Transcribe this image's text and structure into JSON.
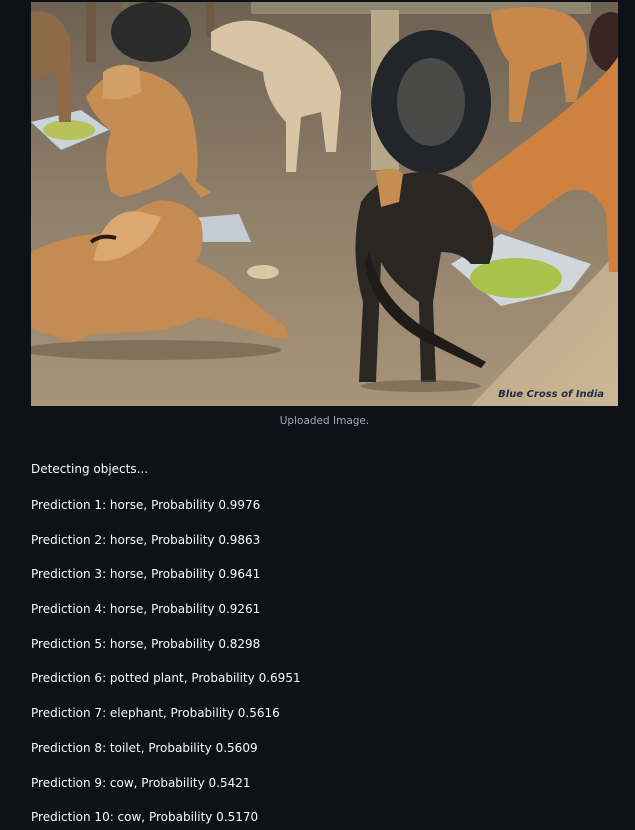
{
  "image": {
    "watermark": "Blue Cross of India",
    "caption": "Uploaded Image."
  },
  "status_text": "Detecting objects...",
  "predictions": [
    "Prediction 1: horse, Probability 0.9976",
    "Prediction 2: horse, Probability 0.9863",
    "Prediction 3: horse, Probability 0.9641",
    "Prediction 4: horse, Probability 0.9261",
    "Prediction 5: horse, Probability 0.8298",
    "Prediction 6: potted plant, Probability 0.6951",
    "Prediction 7: elephant, Probability 0.5616",
    "Prediction 8: toilet, Probability 0.5609",
    "Prediction 9: cow, Probability 0.5421",
    "Prediction 10: cow, Probability 0.5170"
  ],
  "colors": {
    "background": "#0e1117",
    "text": "#fafafa",
    "caption": "#a3a8b4"
  }
}
